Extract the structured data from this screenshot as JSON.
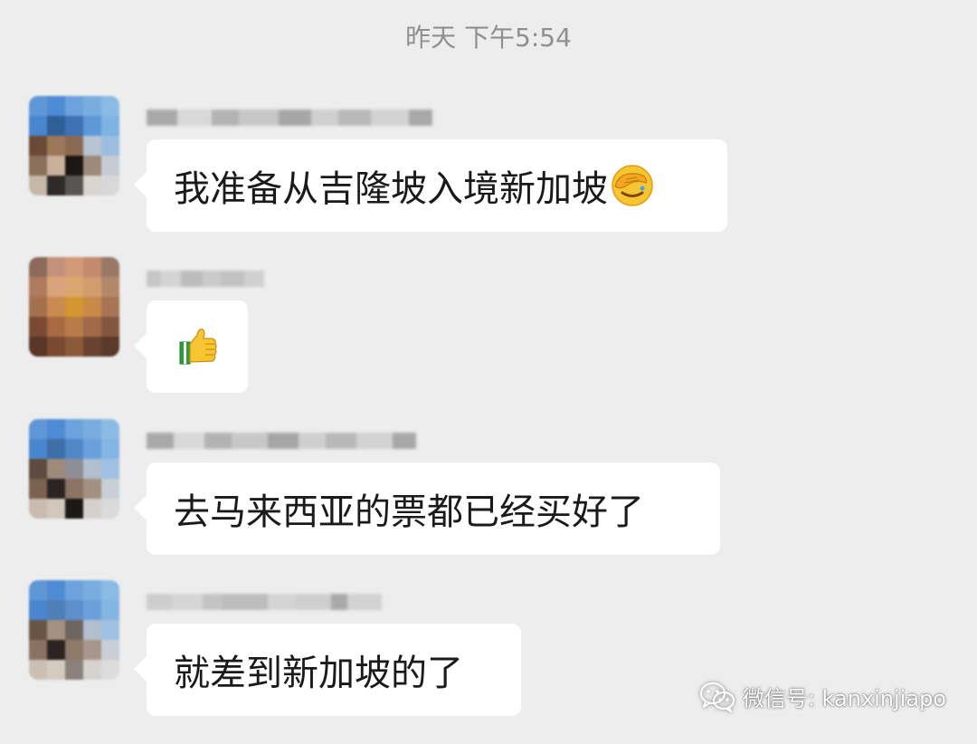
{
  "chat": {
    "timestamp": "昨天 下午5:54",
    "messages": [
      {
        "text": "我准备从吉隆坡入境新加坡",
        "emoji": "facepalm-emoji"
      },
      {
        "text": "",
        "emoji": "thumbs-up-emoji"
      },
      {
        "text": "去马来西亚的票都已经买好了",
        "emoji": ""
      },
      {
        "text": "就差到新加坡的了",
        "emoji": ""
      }
    ]
  },
  "watermark": {
    "label": "微信号: kanxinjiapo",
    "icon": "wechat-icon"
  },
  "colors": {
    "background": "#ededed",
    "bubble": "#ffffff",
    "timestamp": "#8f8f8f",
    "text": "#1a1a1a"
  }
}
